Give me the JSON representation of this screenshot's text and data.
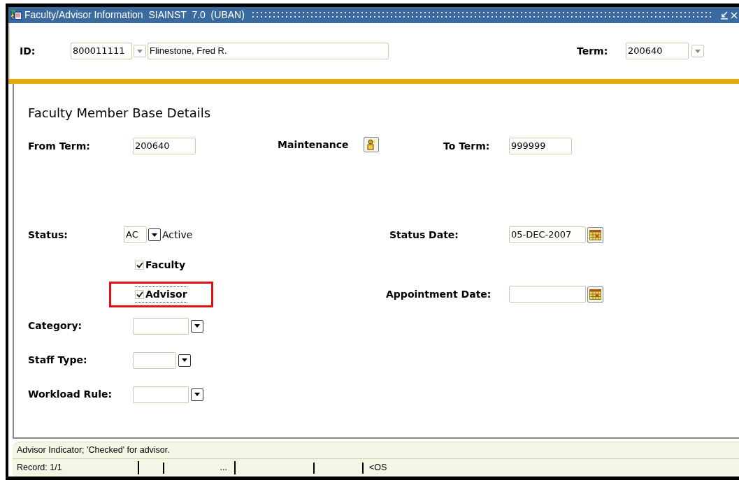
{
  "window": {
    "title": "Faculty/Advisor Information  SIAINST  7.0  (UBAN)"
  },
  "key_block": {
    "id_label": "ID:",
    "id_value": "800011111",
    "name_value": "Flinestone, Fred R.",
    "term_label": "Term:",
    "term_value": "200640"
  },
  "section": {
    "title": "Faculty Member Base Details",
    "from_term": {
      "label": "From Term:",
      "value": "200640"
    },
    "maintenance": {
      "label": "Maintenance"
    },
    "to_term": {
      "label": "To Term:",
      "value": "999999"
    },
    "status": {
      "label": "Status:",
      "code": "AC",
      "description": "Active"
    },
    "status_date": {
      "label": "Status Date:",
      "value": "05-DEC-2007"
    },
    "checkboxes": [
      {
        "label": "Faculty",
        "checked": true,
        "focused": false,
        "highlighted": false
      },
      {
        "label": "Advisor",
        "checked": true,
        "focused": true,
        "highlighted": true
      }
    ],
    "appointment_date": {
      "label": "Appointment Date:"
    },
    "lookups": [
      {
        "label": "Category:"
      },
      {
        "label": "Staff Type:"
      },
      {
        "label": "Workload Rule:"
      }
    ]
  },
  "status_bar": {
    "hint": "Advisor Indicator; 'Checked' for advisor.",
    "record": "Record: 1/1",
    "segment_3": "...",
    "segment_6": "<OS"
  }
}
